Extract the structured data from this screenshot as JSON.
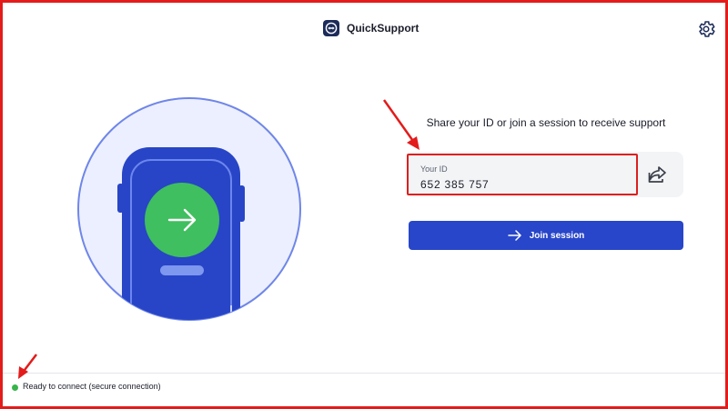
{
  "header": {
    "app_name": "QuickSupport",
    "logo_icon": "teamviewer-logo-icon",
    "settings_icon": "gear-icon"
  },
  "illustration": {
    "icon": "phone-arrow-illustration"
  },
  "main": {
    "headline": "Share your ID or join a session to receive support",
    "id_label": "Your ID",
    "id_value": "652 385 757",
    "share_icon": "share-icon",
    "join_button_label": "Join session",
    "join_button_icon": "arrow-right-icon"
  },
  "status": {
    "text": "Ready to connect (secure connection)",
    "indicator_color": "#38b44a"
  },
  "colors": {
    "accent": "#2846c9",
    "annotation_red": "#e31b1b",
    "illustration_green": "#3fbf5f"
  }
}
